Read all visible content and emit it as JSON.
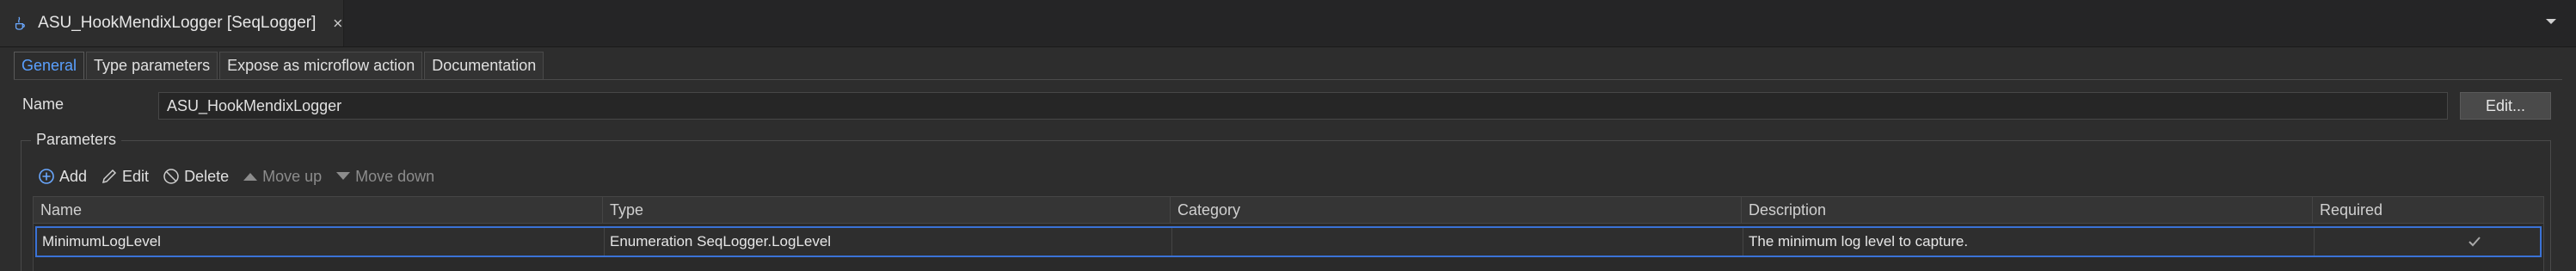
{
  "editor_tab": {
    "title": "ASU_HookMendixLogger [SeqLogger]",
    "icon": "java-action-icon",
    "close_icon": "close-icon"
  },
  "overflow_icon": "chevron-down-icon",
  "subtabs": [
    {
      "label": "General",
      "active": true
    },
    {
      "label": "Type parameters",
      "active": false
    },
    {
      "label": "Expose as microflow action",
      "active": false
    },
    {
      "label": "Documentation",
      "active": false
    }
  ],
  "name_field": {
    "label": "Name",
    "value": "ASU_HookMendixLogger"
  },
  "edit_button": {
    "label": "Edit..."
  },
  "parameters": {
    "legend": "Parameters",
    "toolbar": {
      "add": {
        "label": "Add",
        "icon": "plus-circle-icon",
        "enabled": true
      },
      "edit": {
        "label": "Edit",
        "icon": "pencil-icon",
        "enabled": true
      },
      "delete": {
        "label": "Delete",
        "icon": "no-entry-icon",
        "enabled": true
      },
      "move_up": {
        "label": "Move up",
        "icon": "triangle-up-icon",
        "enabled": false
      },
      "move_down": {
        "label": "Move down",
        "icon": "triangle-down-icon",
        "enabled": false
      }
    },
    "columns": [
      "Name",
      "Type",
      "Category",
      "Description",
      "Required"
    ],
    "rows": [
      {
        "name": "MinimumLogLevel",
        "type": "Enumeration SeqLogger.LogLevel",
        "category": "",
        "description": "The minimum log level to capture.",
        "required": true
      }
    ]
  },
  "colors": {
    "accent": "#5aa0ff",
    "selection_border": "#3a72d6",
    "background": "#2d2d2d"
  }
}
